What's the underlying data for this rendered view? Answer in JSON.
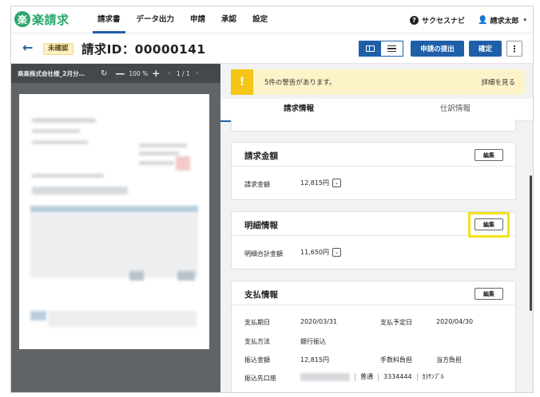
{
  "app": {
    "logo_glyph": "楽",
    "logo_text": "楽請求",
    "brand_color": "#2aa86b",
    "accent_color": "#1f5fa8"
  },
  "nav": {
    "items": [
      {
        "label": "請求書",
        "active": true
      },
      {
        "label": "データ出力",
        "active": false
      },
      {
        "label": "申請",
        "active": false
      },
      {
        "label": "承認",
        "active": false
      },
      {
        "label": "設定",
        "active": false
      }
    ],
    "help_glyph": "?",
    "help_label": "サクセスナビ",
    "user_glyph": "👤",
    "user_name": "請求太郎",
    "user_caret": "▾"
  },
  "header": {
    "back_glyph": "←",
    "status": "未確認",
    "title": "請求ID：00000141",
    "submit_label": "申請の提出",
    "confirm_label": "確定",
    "more_glyph": "⋮"
  },
  "viewer": {
    "file_name": "楽楽株式会社様_2月分…",
    "rotate_glyph": "↻",
    "minus_glyph": "—",
    "zoom": "100 %",
    "plus_glyph": "+",
    "prev_glyph": "‹",
    "page": "1 / 1",
    "next_glyph": "›"
  },
  "alert": {
    "icon_glyph": "!",
    "message": "5件の警告があります。",
    "link": "詳細を見る"
  },
  "tabs": [
    {
      "label": "請求情報",
      "active": true
    },
    {
      "label": "仕訳情報",
      "active": false
    }
  ],
  "sections": {
    "billing_amount": {
      "title": "請求金額",
      "edit": "編集",
      "label": "請求金額",
      "value": "12,815円",
      "chevron": "⌄"
    },
    "details": {
      "title": "明細情報",
      "edit": "編集",
      "label": "明細合計金額",
      "value": "11,650円",
      "chevron": "⌄"
    },
    "payment": {
      "title": "支払情報",
      "edit": "編集",
      "due_date_label": "支払期日",
      "due_date": "2020/03/31",
      "planned_date_label": "支払予定日",
      "planned_date": "2020/04/30",
      "method_label": "支払方法",
      "method": "銀行振込",
      "transfer_amount_label": "振込金額",
      "transfer_amount": "12,815円",
      "fee_label": "手数料負担",
      "fee": "当方負担",
      "account_label": "振込先口座",
      "account_type": "普通",
      "account_number": "3334444",
      "account_holder": "ｶ)ｻﾝﾌﾟﾙ"
    }
  }
}
